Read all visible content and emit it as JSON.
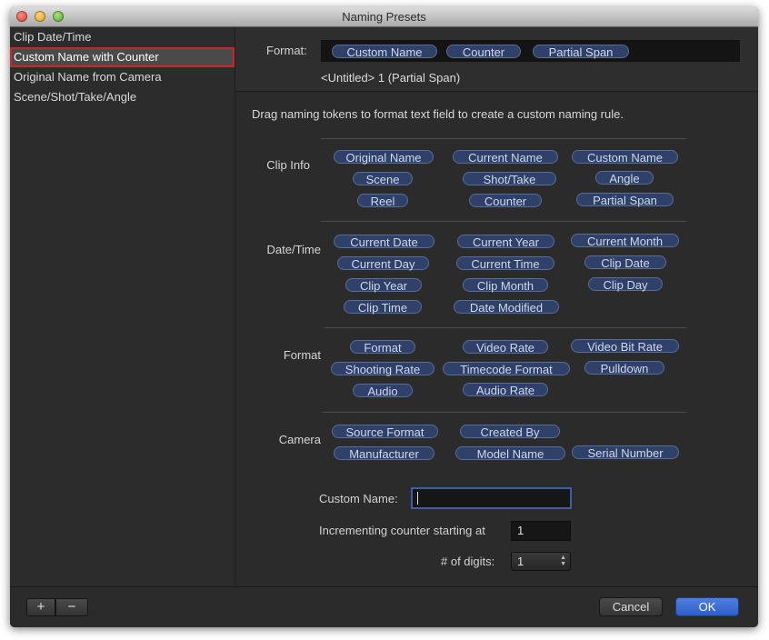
{
  "window": {
    "title": "Naming Presets"
  },
  "sidebar": {
    "items": [
      {
        "label": "Clip Date/Time"
      },
      {
        "label": "Custom Name with Counter",
        "selected": true
      },
      {
        "label": "Original Name from Camera"
      },
      {
        "label": "Scene/Shot/Take/Angle"
      }
    ]
  },
  "format": {
    "label": "Format:",
    "tokens": [
      "Custom Name",
      "Counter",
      "Partial Span"
    ],
    "preview": "<Untitled> 1 (Partial Span)"
  },
  "hint": "Drag naming tokens to format text field to create a custom naming rule.",
  "groups": [
    {
      "label": "Clip Info",
      "tokens": [
        "Original Name",
        "Current Name",
        "Custom Name",
        "Scene",
        "Shot/Take",
        "Angle",
        "Reel",
        "Counter",
        "Partial Span"
      ]
    },
    {
      "label": "Date/Time",
      "tokens": [
        "Current Date",
        "Current Year",
        "Current Month",
        "Current Day",
        "Current Time",
        "Clip Date",
        "Clip Year",
        "Clip Month",
        "Clip Day",
        "Clip Time",
        "Date Modified"
      ]
    },
    {
      "label": "Format",
      "tokens": [
        "Format",
        "Video Rate",
        "Video Bit Rate",
        "Shooting Rate",
        "Timecode Format",
        "Pulldown",
        "Audio",
        "Audio Rate"
      ]
    },
    {
      "label": "Camera",
      "tokens": [
        "Source Format",
        "Created By",
        "Manufacturer",
        "Model Name",
        "Serial Number"
      ]
    }
  ],
  "fields": {
    "custom_name_label": "Custom Name:",
    "custom_name_value": "",
    "counter_label": "Incrementing counter starting at",
    "counter_value": "1",
    "digits_label": "# of digits:",
    "digits_value": "1"
  },
  "buttons": {
    "add": "+",
    "remove": "−",
    "cancel": "Cancel",
    "ok": "OK"
  },
  "colors": {
    "accent": "#2e5fc5",
    "token_fill": "#2f4168",
    "selection_border": "#d0232a"
  }
}
